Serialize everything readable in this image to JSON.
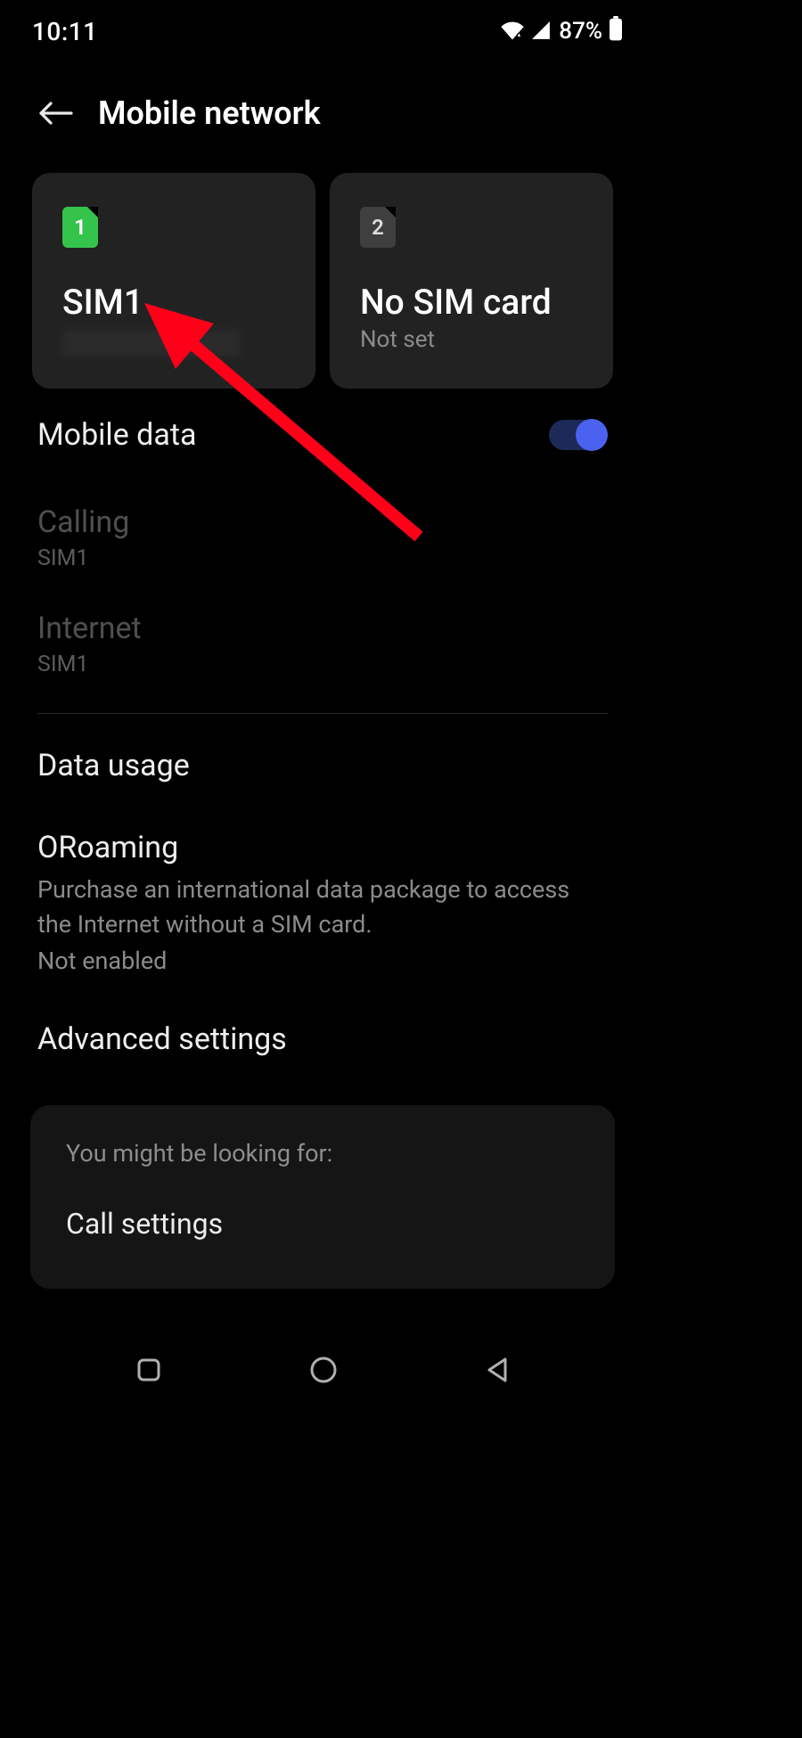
{
  "status": {
    "time": "10:11",
    "battery_pct": "87%"
  },
  "header": {
    "title": "Mobile network"
  },
  "sim_cards": [
    {
      "slot": "1",
      "title": "SIM1",
      "subtitle": "",
      "chip_color": "green",
      "has_sim": true
    },
    {
      "slot": "2",
      "title": "No SIM card",
      "subtitle": "Not set",
      "chip_color": "grey",
      "has_sim": false
    }
  ],
  "settings": {
    "mobile_data": {
      "label": "Mobile data",
      "enabled": true
    },
    "calling": {
      "label": "Calling",
      "value": "SIM1"
    },
    "internet": {
      "label": "Internet",
      "value": "SIM1"
    },
    "data_usage": {
      "label": "Data usage"
    },
    "oroaming": {
      "label": "ORoaming",
      "description": "Purchase an international data package to access the Internet without a SIM card.",
      "status": "Not enabled"
    },
    "advanced": {
      "label": "Advanced settings"
    }
  },
  "suggestion": {
    "heading": "You might be looking for:",
    "item": "Call settings"
  },
  "annotation": {
    "type": "arrow",
    "color": "#ff0019"
  }
}
